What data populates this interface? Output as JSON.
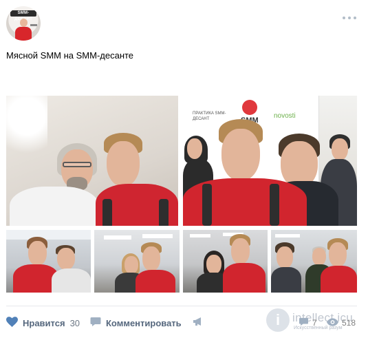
{
  "post": {
    "avatar_logo_text": "SMM-ДЕСАНТ",
    "text": "Мясной SMM на SMM-десанте"
  },
  "photos": [
    {
      "alt": "photo-1"
    },
    {
      "alt": "photo-2"
    },
    {
      "alt": "photo-3"
    },
    {
      "alt": "photo-4"
    },
    {
      "alt": "photo-5"
    },
    {
      "alt": "photo-6"
    }
  ],
  "banner": {
    "smm_text": "SMM",
    "brand_text": "novosti",
    "small_text": "ПРАКТИКА SMM-ДЕСАНТ"
  },
  "actions": {
    "like_label": "Нравится",
    "like_count": "30",
    "comment_label": "Комментировать",
    "comments_count": "7",
    "views_count": "518"
  },
  "watermark": {
    "letter": "i",
    "title": "intellect.icu",
    "subtitle": "Искусственный разум"
  },
  "colors": {
    "accent": "#55677d",
    "icon": "#a0b0c2",
    "heart": "#5181b8",
    "shirt_red": "#d1252e"
  }
}
